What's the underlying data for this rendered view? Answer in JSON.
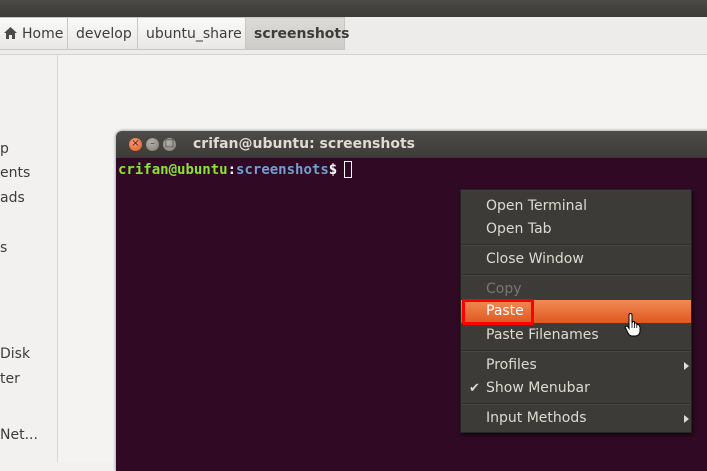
{
  "breadcrumbs": [
    {
      "label": "Home",
      "icon": "home-icon"
    },
    {
      "label": "develop"
    },
    {
      "label": "ubuntu_share"
    },
    {
      "label": "screenshots",
      "active": true
    }
  ],
  "sidebar": {
    "items": [
      "p",
      "ents",
      "ads",
      "s",
      "Disk",
      "ter",
      "Net..."
    ]
  },
  "terminal": {
    "title": "crifan@ubuntu: screenshots",
    "prompt": {
      "user": "crifan",
      "at": "@",
      "host": "ubuntu",
      "colon": ":",
      "dir": "screenshots",
      "dollar": "$"
    }
  },
  "context_menu": {
    "items": [
      {
        "label": "Open Terminal"
      },
      {
        "label": "Open Tab"
      },
      {
        "label": "Close Window"
      },
      {
        "label": "Copy",
        "disabled": true
      },
      {
        "label": "Paste",
        "highlighted": true
      },
      {
        "label": "Paste Filenames"
      },
      {
        "label": "Profiles",
        "submenu": true
      },
      {
        "label": "Show Menubar",
        "checked": true
      },
      {
        "label": "Input Methods",
        "submenu": true
      }
    ]
  },
  "colors": {
    "terminal_bg": "#300a24",
    "menu_bg": "#3c3b37",
    "highlight": "#e8622a",
    "annotation": "#ff0000"
  }
}
